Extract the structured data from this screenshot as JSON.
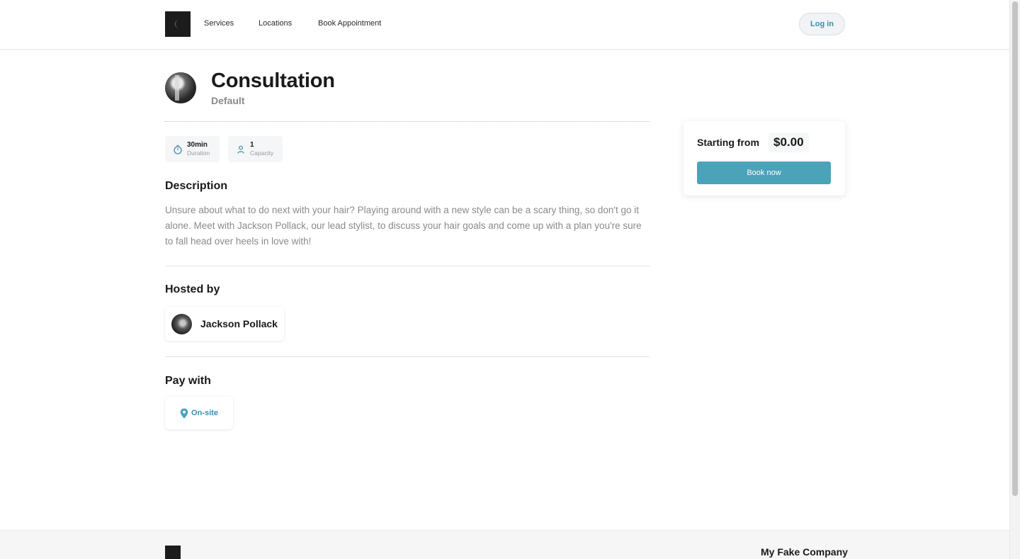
{
  "header": {
    "nav": [
      "Services",
      "Locations",
      "Book Appointment"
    ],
    "login_label": "Log in"
  },
  "service": {
    "title": "Consultation",
    "subtitle": "Default",
    "duration_value": "30min",
    "duration_label": "Duration",
    "capacity_value": "1",
    "capacity_label": "Capacity"
  },
  "description": {
    "heading": "Description",
    "text": "Unsure about what to do next with your hair? Playing around with a new style can be a scary thing, so don't go it alone. Meet with Jackson Pollack, our lead stylist, to discuss your hair goals and come up with a plan you're sure to fall head over heels in love with!"
  },
  "hosted": {
    "heading": "Hosted by",
    "host_name": "Jackson Pollack"
  },
  "payment": {
    "heading": "Pay with",
    "method": "On-site"
  },
  "pricing": {
    "label": "Starting from",
    "price": "$0.00",
    "book_label": "Book now"
  },
  "footer": {
    "company": "My Fake Company"
  },
  "colors": {
    "accent": "#4ba3b9",
    "link": "#3d8cab"
  }
}
